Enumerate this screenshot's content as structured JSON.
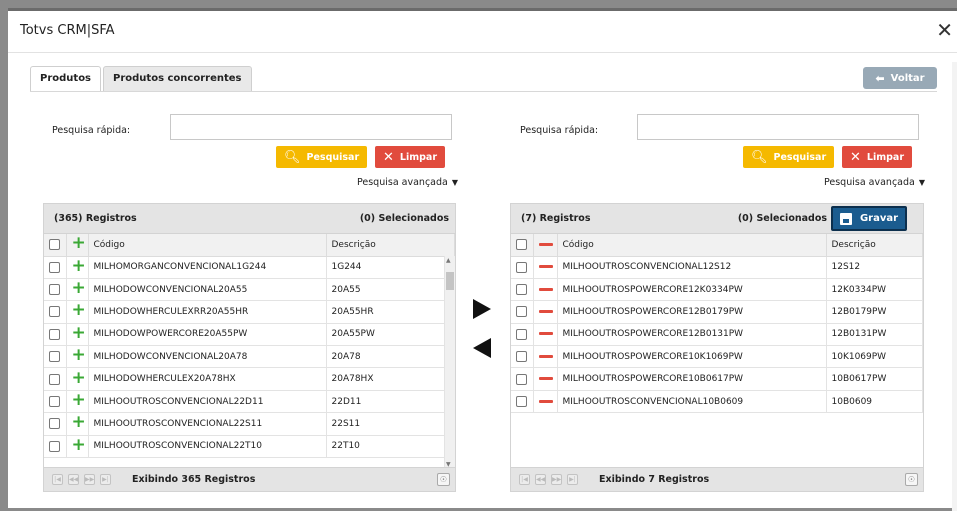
{
  "window": {
    "title": "Totvs CRM|SFA",
    "close_glyph": "✕"
  },
  "tabs": [
    {
      "label": "Produtos",
      "active": true
    },
    {
      "label": "Produtos concorrentes",
      "active": false
    }
  ],
  "back_button": {
    "label": "Voltar",
    "icon": "arrow-left-icon"
  },
  "left": {
    "search_label": "Pesquisa rápida:",
    "search_value": "",
    "search_button": "Pesquisar",
    "clear_button": "Limpar",
    "advanced": "Pesquisa avançada",
    "count_label": "(365) Registros",
    "selected_label": "(0) Selecionados",
    "columns": [
      "Código",
      "Descrição"
    ],
    "rows": [
      {
        "codigo": "MILHOMORGANCONVENCIONAL1G244",
        "descricao": "1G244"
      },
      {
        "codigo": "MILHODOWCONVENCIONAL20A55",
        "descricao": "20A55"
      },
      {
        "codigo": "MILHODOWHERCULEXRR20A55HR",
        "descricao": "20A55HR"
      },
      {
        "codigo": "MILHODOWPOWERCORE20A55PW",
        "descricao": "20A55PW"
      },
      {
        "codigo": "MILHODOWCONVENCIONAL20A78",
        "descricao": "20A78"
      },
      {
        "codigo": "MILHODOWHERCULEX20A78HX",
        "descricao": "20A78HX"
      },
      {
        "codigo": "MILHOOUTROSCONVENCIONAL22D11",
        "descricao": "22D11"
      },
      {
        "codigo": "MILHOOUTROSCONVENCIONAL22S11",
        "descricao": "22S11"
      },
      {
        "codigo": "MILHOOUTROSCONVENCIONAL22T10",
        "descricao": "22T10"
      }
    ],
    "footer": "Exibindo 365 Registros"
  },
  "right": {
    "search_label": "Pesquisa rápida:",
    "search_value": "",
    "search_button": "Pesquisar",
    "clear_button": "Limpar",
    "advanced": "Pesquisa avançada",
    "count_label": "(7) Registros",
    "selected_label": "(0) Selecionados",
    "save_button": "Gravar",
    "columns": [
      "Código",
      "Descrição"
    ],
    "rows": [
      {
        "codigo": "MILHOOUTROSCONVENCIONAL12S12",
        "descricao": "12S12"
      },
      {
        "codigo": "MILHOOUTROSPOWERCORE12K0334PW",
        "descricao": "12K0334PW"
      },
      {
        "codigo": "MILHOOUTROSPOWERCORE12B0179PW",
        "descricao": "12B0179PW"
      },
      {
        "codigo": "MILHOOUTROSPOWERCORE12B0131PW",
        "descricao": "12B0131PW"
      },
      {
        "codigo": "MILHOOUTROSPOWERCORE10K1069PW",
        "descricao": "10K1069PW"
      },
      {
        "codigo": "MILHOOUTROSPOWERCORE10B0617PW",
        "descricao": "10B0617PW"
      },
      {
        "codigo": "MILHOOUTROSCONVENCIONAL10B0609",
        "descricao": "10B0609"
      }
    ],
    "footer": "Exibindo 7 Registros"
  },
  "colors": {
    "accent_yellow": "#f5b900",
    "accent_red": "#e14b3d",
    "save_blue": "#1b5c8f",
    "add_green": "#3aa835"
  }
}
